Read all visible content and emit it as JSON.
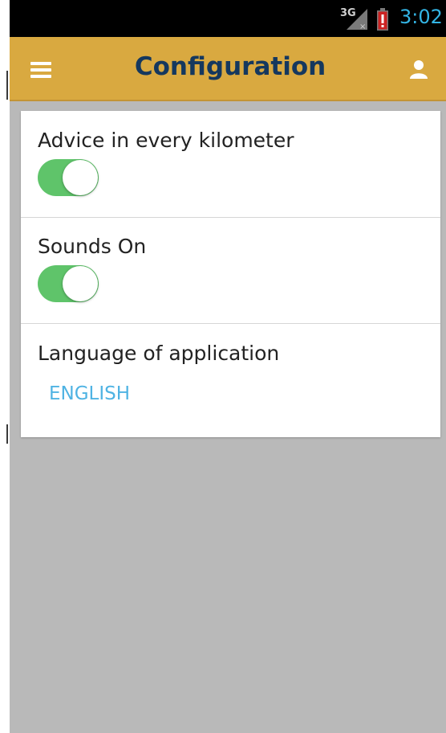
{
  "status_bar": {
    "network": "3G",
    "time": "3:02",
    "icons": [
      "signal-icon",
      "battery-alert-icon"
    ],
    "time_color": "#33b5e5"
  },
  "app_bar": {
    "title": "Configuration",
    "icons": [
      "menu-icon",
      "user-icon"
    ],
    "background_color": "#d9a940",
    "title_color": "#15385e"
  },
  "settings": [
    {
      "label": "Advice in every kilometer",
      "type": "toggle",
      "enabled": true
    },
    {
      "label": "Sounds On",
      "type": "toggle",
      "enabled": true
    },
    {
      "label": "Language of application",
      "type": "select",
      "value": "ENGLISH"
    }
  ],
  "colors": {
    "toggle_on": "#5fc46a",
    "link": "#4fb3e3",
    "background": "#b9b9b9"
  }
}
